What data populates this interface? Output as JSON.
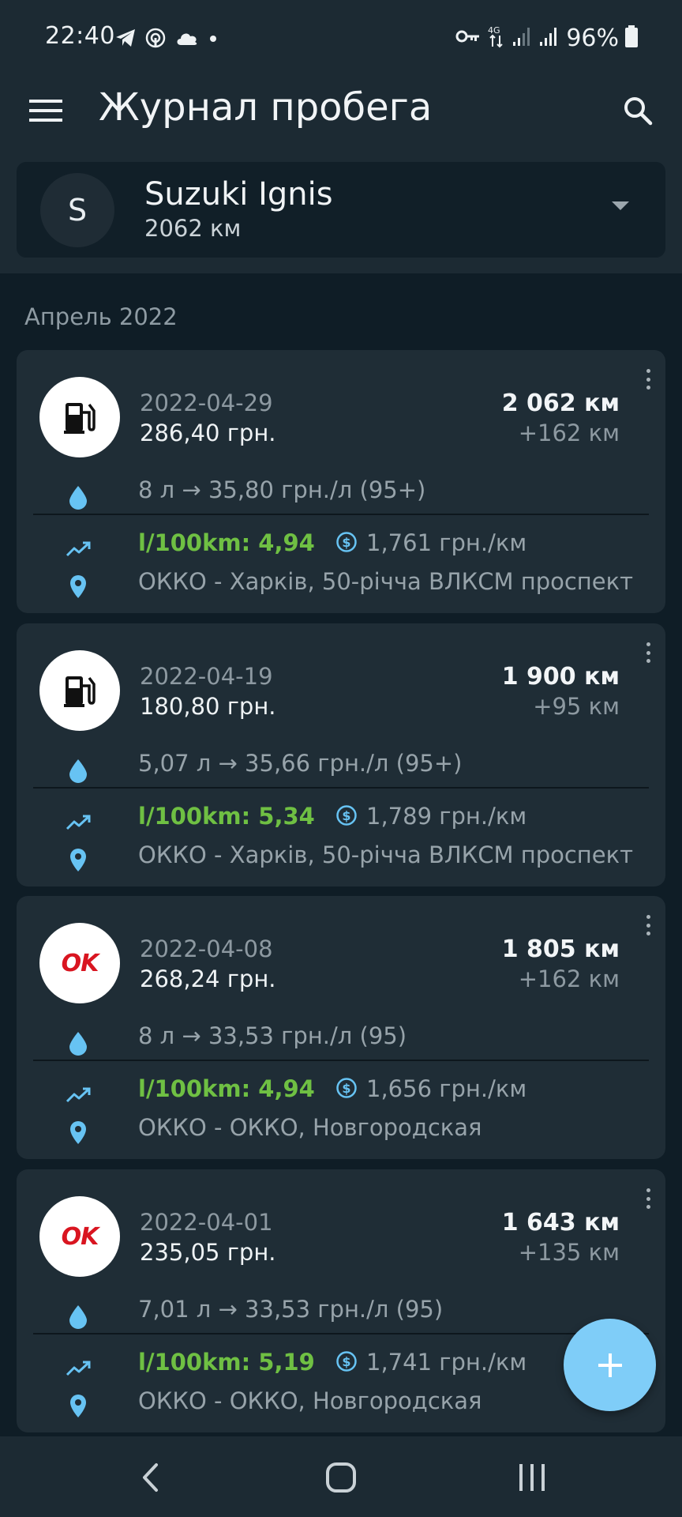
{
  "status_bar": {
    "time": "22:40",
    "battery": "96%",
    "icons_left": [
      "telegram-icon",
      "podcast-icon",
      "cloud-icon",
      "dot-icon"
    ],
    "icons_right": [
      "vpn-key-icon",
      "4g-data-icon",
      "signal-icon",
      "signal-icon",
      "battery-icon"
    ]
  },
  "appbar": {
    "title": "Журнал пробега",
    "menu_icon": "menu-icon",
    "search_icon": "search-icon"
  },
  "vehicle": {
    "avatar": "S",
    "name": "Suzuki Ignis",
    "odometer": "2062 км"
  },
  "section": {
    "title": "Апрель 2022"
  },
  "entries": [
    {
      "logo": "fuel-pump-icon",
      "date": "2022-04-29",
      "price": "286,40 грн.",
      "odometer": "2 062 км",
      "delta": "+162 км",
      "fuel": "8 л  →  35,80 грн./л (95+)",
      "consumption": "l/100km: 4,94",
      "cost_per_km": "1,761 грн./км",
      "station": "ОККО - Харків, 50-річча ВЛКСМ проспект"
    },
    {
      "logo": "fuel-pump-icon",
      "date": "2022-04-19",
      "price": "180,80 грн.",
      "odometer": "1 900 км",
      "delta": "+95 км",
      "fuel": "5,07 л  →  35,66 грн./л (95+)",
      "consumption": "l/100km: 5,34",
      "cost_per_km": "1,789 грн./км",
      "station": "ОККО - Харків, 50-річча ВЛКСМ проспект"
    },
    {
      "logo": "OK",
      "date": "2022-04-08",
      "price": "268,24 грн.",
      "odometer": "1 805 км",
      "delta": "+162 км",
      "fuel": "8 л  →  33,53 грн./л (95)",
      "consumption": "l/100km: 4,94",
      "cost_per_km": "1,656 грн./км",
      "station": "ОККО - ОККО, Новгородская"
    },
    {
      "logo": "OK",
      "date": "2022-04-01",
      "price": "235,05 грн.",
      "odometer": "1 643 км",
      "delta": "+135 км",
      "fuel": "7,01 л  →  33,53 грн./л (95)",
      "consumption": "l/100km: 5,19",
      "cost_per_km": "1,741 грн./км",
      "station": "ОККО - ОККО, Новгородская"
    }
  ],
  "fab": {
    "icon": "plus-icon"
  },
  "colors": {
    "background": "#0f1d26",
    "card": "#1f2d36",
    "accent": "#7fcdf8",
    "consumption_green": "#6fc043",
    "ok_brand_red": "#d91520"
  }
}
